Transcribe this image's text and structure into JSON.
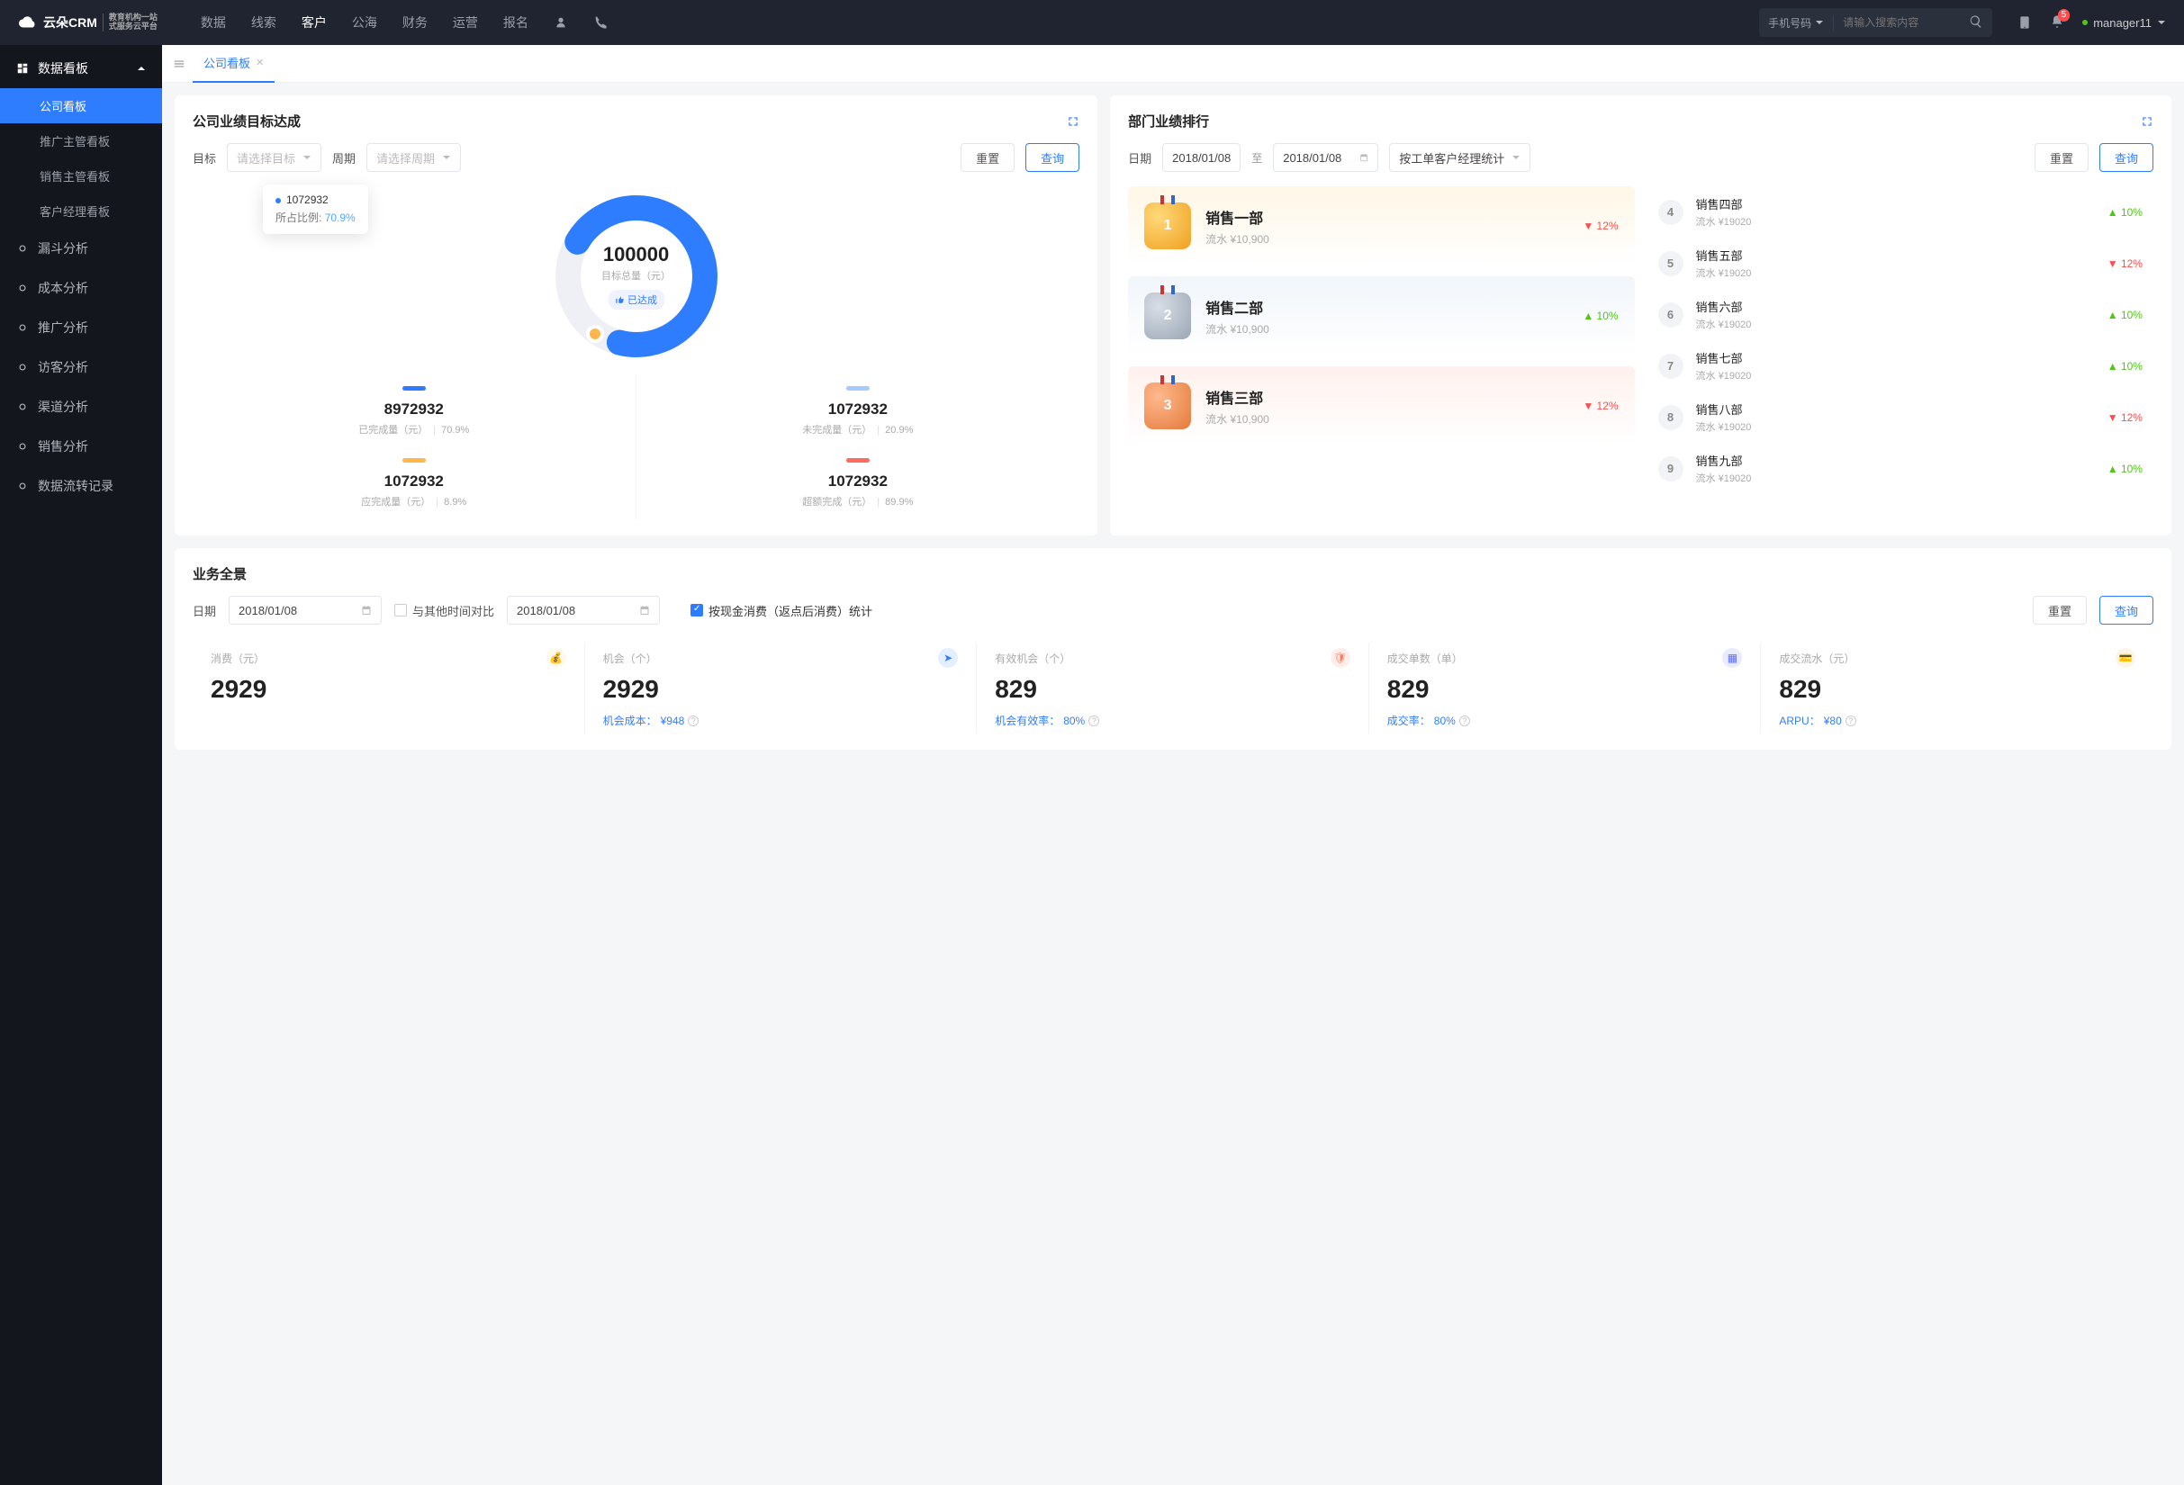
{
  "topnav": {
    "brand": "云朵CRM",
    "brand_sub1": "教育机构一站",
    "brand_sub2": "式服务云平台",
    "items": [
      "数据",
      "线索",
      "客户",
      "公海",
      "财务",
      "运营",
      "报名"
    ],
    "active_index": 2,
    "search_type": "手机号码",
    "search_placeholder": "请输入搜索内容",
    "notif_count": "5",
    "username": "manager11"
  },
  "sidebar": {
    "group_title": "数据看板",
    "subs": [
      "公司看板",
      "推广主管看板",
      "销售主管看板",
      "客户经理看板"
    ],
    "sub_active": 0,
    "items": [
      "漏斗分析",
      "成本分析",
      "推广分析",
      "访客分析",
      "渠道分析",
      "销售分析",
      "数据流转记录"
    ]
  },
  "tab": {
    "title": "公司看板"
  },
  "target": {
    "title": "公司业绩目标达成",
    "label_goal": "目标",
    "goal_placeholder": "请选择目标",
    "label_period": "周期",
    "period_placeholder": "请选择周期",
    "btn_reset": "重置",
    "btn_query": "查询",
    "tooltip_value": "1072932",
    "tooltip_label": "所占比例:",
    "tooltip_pct": "70.9%",
    "center_value": "100000",
    "center_label": "目标总量（元）",
    "chip_text": "已达成",
    "stats": [
      {
        "pill": "#2f7dff",
        "value": "8972932",
        "label": "已完成量（元）",
        "pct": "70.9%"
      },
      {
        "pill": "#a7caff",
        "value": "1072932",
        "label": "未完成量（元）",
        "pct": "20.9%"
      },
      {
        "pill": "#ffb64d",
        "value": "1072932",
        "label": "应完成量（元）",
        "pct": "8.9%"
      },
      {
        "pill": "#ff6b5e",
        "value": "1072932",
        "label": "超额完成（元）",
        "pct": "89.9%"
      }
    ]
  },
  "ranking": {
    "title": "部门业绩排行",
    "label_date": "日期",
    "date_from": "2018/01/08",
    "date_sep": "至",
    "date_to": "2018/01/08",
    "select_text": "按工单客户经理统计",
    "btn_reset": "重置",
    "btn_query": "查询",
    "sub_prefix": "流水 ",
    "top3": [
      {
        "rank": "1",
        "name": "销售一部",
        "amount": "¥10,900",
        "trend": "12%",
        "dir": "down"
      },
      {
        "rank": "2",
        "name": "销售二部",
        "amount": "¥10,900",
        "trend": "10%",
        "dir": "up"
      },
      {
        "rank": "3",
        "name": "销售三部",
        "amount": "¥10,900",
        "trend": "12%",
        "dir": "down"
      }
    ],
    "rest": [
      {
        "rank": "4",
        "name": "销售四部",
        "amount": "¥19020",
        "trend": "10%",
        "dir": "up"
      },
      {
        "rank": "5",
        "name": "销售五部",
        "amount": "¥19020",
        "trend": "12%",
        "dir": "down"
      },
      {
        "rank": "6",
        "name": "销售六部",
        "amount": "¥19020",
        "trend": "10%",
        "dir": "up"
      },
      {
        "rank": "7",
        "name": "销售七部",
        "amount": "¥19020",
        "trend": "10%",
        "dir": "up"
      },
      {
        "rank": "8",
        "name": "销售八部",
        "amount": "¥19020",
        "trend": "12%",
        "dir": "down"
      },
      {
        "rank": "9",
        "name": "销售九部",
        "amount": "¥19020",
        "trend": "10%",
        "dir": "up"
      }
    ]
  },
  "overview": {
    "title": "业务全景",
    "label_date": "日期",
    "date1": "2018/01/08",
    "compare_label": "与其他时间对比",
    "date2": "2018/01/08",
    "checkbox_label": "按现金消费（返点后消费）统计",
    "btn_reset": "重置",
    "btn_query": "查询",
    "kpis": [
      {
        "label": "消费（元）",
        "value": "2929",
        "sub_label": "",
        "sub_value": "",
        "color": "#ffd479"
      },
      {
        "label": "机会（个）",
        "value": "2929",
        "sub_label": "机会成本：",
        "sub_value": "¥948",
        "color": "#2f7dff"
      },
      {
        "label": "有效机会（个）",
        "value": "829",
        "sub_label": "机会有效率：",
        "sub_value": "80%",
        "color": "#ff7a59"
      },
      {
        "label": "成交单数（单）",
        "value": "829",
        "sub_label": "成交率：",
        "sub_value": "80%",
        "color": "#5b6cff"
      },
      {
        "label": "成交流水（元）",
        "value": "829",
        "sub_label": "ARPU：",
        "sub_value": "¥80",
        "color": "#ffb64d"
      }
    ]
  },
  "chart_data": {
    "type": "pie",
    "title": "公司业绩目标达成",
    "total_label": "目标总量（元）",
    "total_value": 100000,
    "series": [
      {
        "name": "已完成量（元）",
        "value": 8972932,
        "pct": 70.9,
        "color": "#2f7dff"
      },
      {
        "name": "未完成量（元）",
        "value": 1072932,
        "pct": 20.9,
        "color": "#a7caff"
      },
      {
        "name": "应完成量（元）",
        "value": 1072932,
        "pct": 8.9,
        "color": "#ffb64d"
      },
      {
        "name": "超额完成（元）",
        "value": 1072932,
        "pct": 89.9,
        "color": "#ff6b5e"
      }
    ],
    "status": "已达成",
    "highlight": {
      "value": 1072932,
      "pct": 70.9
    }
  }
}
